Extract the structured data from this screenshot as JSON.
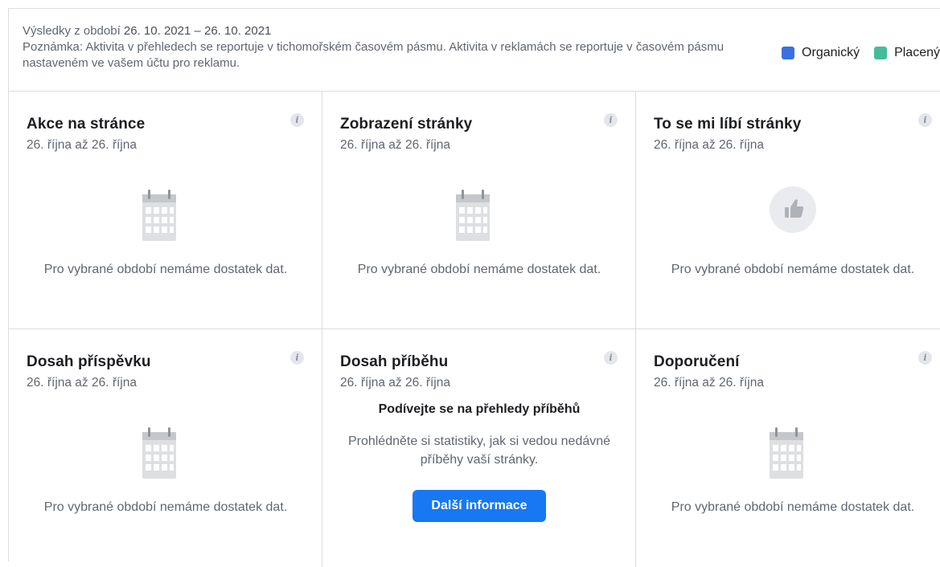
{
  "header": {
    "results_prefix": "Výsledky z období ",
    "date_range": "26. 10. 2021 – 26. 10. 2021",
    "note": "Poznámka: Aktivita v přehledech se reportuje v tichomořském časovém pásmu. Aktivita v reklamách se reportuje v časovém pásmu nastaveném ve vašem účtu pro reklamu."
  },
  "legend": {
    "items": [
      {
        "label": "Organický",
        "color": "#3b6fe0"
      },
      {
        "label": "Placený",
        "color": "#42bd9c"
      }
    ]
  },
  "cards": [
    {
      "title": "Akce na stránce",
      "date": "26. října až 26. října",
      "icon": "calendar-icon",
      "message": "Pro vybrané období nemáme dostatek dat."
    },
    {
      "title": "Zobrazení stránky",
      "date": "26. října až 26. října",
      "icon": "calendar-icon",
      "message": "Pro vybrané období nemáme dostatek dat."
    },
    {
      "title": "To se mi líbí stránky",
      "date": "26. října až 26. října",
      "icon": "thumbs-up-icon",
      "message": "Pro vybrané období nemáme dostatek dat."
    },
    {
      "title": "Dosah příspěvku",
      "date": "26. října až 26. října",
      "icon": "calendar-icon",
      "message": "Pro vybrané období nemáme dostatek dat."
    },
    {
      "title": "Dosah příběhu",
      "date": "26. října až 26. října",
      "heading": "Podívejte se na přehledy příběhů",
      "description": "Prohlédněte si statistiky, jak si vedou nedávné příběhy vaší stránky.",
      "button_label": "Další informace"
    },
    {
      "title": "Doporučení",
      "date": "26. října až 26. října",
      "icon": "calendar-icon",
      "message": "Pro vybrané období nemáme dostatek dat."
    }
  ],
  "info_icon_glyph": "i",
  "colors": {
    "accent": "#1877f2",
    "border": "#dadde1",
    "muted_text": "#606770"
  }
}
